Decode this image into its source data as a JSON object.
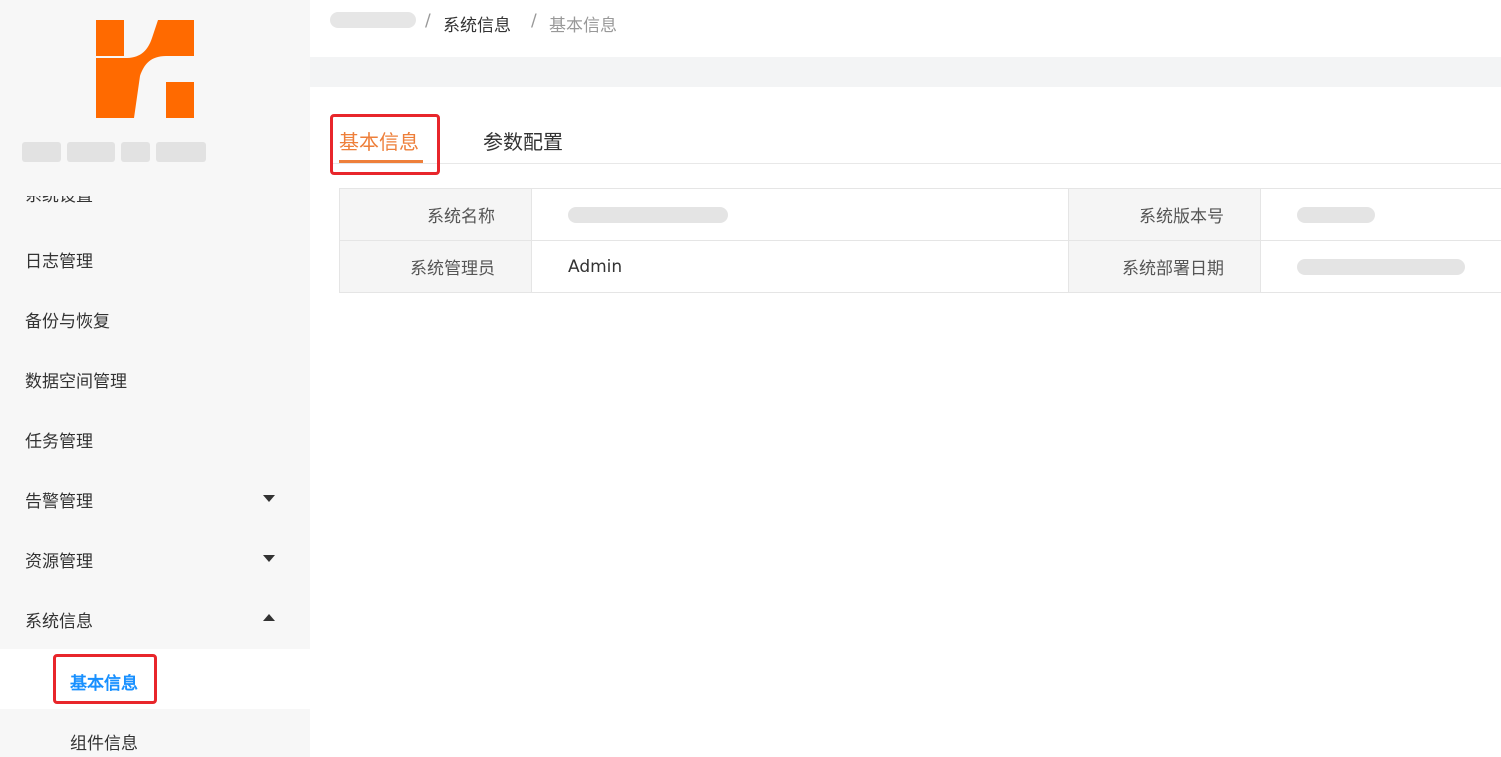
{
  "colors": {
    "accent": "#ee7f3a",
    "active_link": "#1890ff",
    "highlight_box": "#e8262b",
    "logo": "#ff6a00"
  },
  "sidebar": {
    "logo_icon": "company-logo",
    "clipped_label": "系统设置",
    "items": [
      {
        "label": "日志管理"
      },
      {
        "label": "备份与恢复"
      },
      {
        "label": "数据空间管理"
      },
      {
        "label": "任务管理"
      },
      {
        "label": "告警管理",
        "icon": "chevron-down-icon"
      },
      {
        "label": "资源管理",
        "icon": "chevron-down-icon"
      },
      {
        "label": "系统信息",
        "icon": "chevron-up-icon"
      }
    ],
    "subitems": [
      {
        "label": "基本信息",
        "active": true
      },
      {
        "label": "组件信息"
      }
    ]
  },
  "breadcrumb": {
    "separator": "/",
    "items": [
      "系统信息",
      "基本信息"
    ]
  },
  "tabs": [
    {
      "label": "基本信息",
      "active": true
    },
    {
      "label": "参数配置"
    }
  ],
  "info": {
    "rows": [
      [
        {
          "label": "系统名称",
          "value": ""
        },
        {
          "label": "系统版本号",
          "value": ""
        }
      ],
      [
        {
          "label": "系统管理员",
          "value": "Admin"
        },
        {
          "label": "系统部署日期",
          "value": ""
        }
      ]
    ]
  }
}
